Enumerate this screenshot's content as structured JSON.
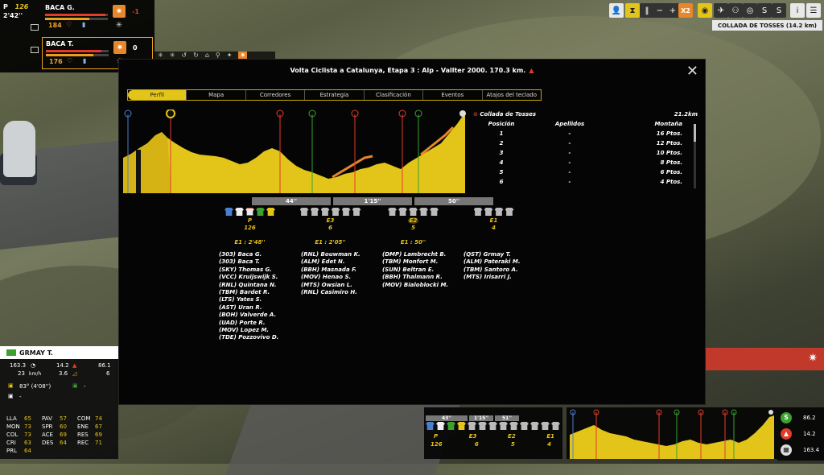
{
  "riders_panel": {
    "label_p": "P",
    "position": "126",
    "gap": "2'42''",
    "riders": [
      {
        "name": "BACA G.",
        "value": "184",
        "delta": "-1",
        "selected": false
      },
      {
        "name": "BACA T.",
        "value": "176",
        "delta": "0",
        "selected": true
      }
    ]
  },
  "toolbar": {
    "speed": "X2",
    "location": "COLLADA DE TOSSES (14.2 km)"
  },
  "dialog": {
    "title": "Volta Ciclista a Catalunya, Etapa 3 : Alp - Vallter 2000. 170.3 km.",
    "tabs": [
      "Perfil",
      "Mapa",
      "Corredores",
      "Estrategia",
      "Clasificación",
      "Eventos",
      "Atajos del teclado"
    ],
    "active_tab": "Perfil",
    "climb": {
      "name": "Collada de Tosses",
      "distance": "21.2km"
    },
    "headers": [
      "Posición",
      "Apellidos",
      "Montaña"
    ],
    "rows": [
      [
        "1",
        "-",
        "16 Ptos."
      ],
      [
        "2",
        "-",
        "12 Ptos."
      ],
      [
        "3",
        "-",
        "10 Ptos."
      ],
      [
        "4",
        "-",
        "8 Ptos."
      ],
      [
        "5",
        "-",
        "6 Ptos."
      ],
      [
        "6",
        "-",
        "4 Ptos."
      ]
    ],
    "gaps": [
      "44''",
      "1'15''",
      "50''"
    ],
    "groups": [
      {
        "code": "P",
        "count": "126",
        "time": "E1 : 2'48''",
        "names": [
          "(303) Baca G.",
          "(303) Baca T.",
          "(SKY) Thomas G.",
          "(VCC) Kruijswijk S.",
          "(RNL) Quintana N.",
          "(TBM) Bardet R.",
          "(LTS) Yates S.",
          "(AST) Uran R.",
          "(BOH) Valverde A.",
          "(UAD) Porte R.",
          "(MOV) Lopez M.",
          "(TDE) Pozzovivo D."
        ]
      },
      {
        "code": "E3",
        "count": "6",
        "time": "E1 : 2'05''",
        "names": [
          "(RNL) Bouwman K.",
          "(ALM) Edet N.",
          "(BBH) Masnada F.",
          "(MOV) Henao S.",
          "(MTS) Owsian L.",
          "(RNL) Casimiro H."
        ]
      },
      {
        "code": "E2",
        "count": "5",
        "time": "E1 : 50''",
        "names": [
          "(DMP) Lambrecht B.",
          "(TBM) Monfort M.",
          "(SUN) Beltran E.",
          "(BBH) Thalmann R.",
          "(MOV) Bialoblocki M."
        ]
      },
      {
        "code": "E1",
        "count": "4",
        "time": "",
        "names": [
          "(QST) Grmay T.",
          "(ALM) Pateraki M.",
          "(TBM) Santoro A.",
          "(MTS) Irisarri J."
        ]
      }
    ]
  },
  "rider_info": {
    "name": "GRMAY T.",
    "dist": "163.3",
    "speed": "23",
    "speed_unit": "km/h",
    "val1": "14.2",
    "val2": "3.6",
    "val3": "86.1",
    "val4": "6",
    "temp": "83° (4'08'')",
    "dash1": "-",
    "dash2": "-",
    "skills": [
      [
        "LLA",
        "65",
        "PAV",
        "57",
        "COM",
        "74"
      ],
      [
        "MON",
        "73",
        "SPR",
        "60",
        "ENE",
        "67"
      ],
      [
        "COL",
        "73",
        "ACE",
        "69",
        "RES",
        "69"
      ],
      [
        "CRI",
        "63",
        "DES",
        "64",
        "REC",
        "71"
      ],
      [
        "PRL",
        "64",
        "",
        "",
        "",
        ""
      ]
    ]
  },
  "mini_groups": {
    "gaps": [
      "43''",
      "1'15''",
      "51''"
    ],
    "codes": [
      "P",
      "E3",
      "E2",
      "E1"
    ],
    "counts": [
      "126",
      "6",
      "5",
      "4"
    ]
  },
  "right_stats": {
    "v1": "86.2",
    "v2": "14.2",
    "v3": "163.4"
  },
  "colors": {
    "accent": "#e3c51a",
    "red": "#e23b2b",
    "orange": "#e8862a",
    "green": "#3ca12f"
  }
}
